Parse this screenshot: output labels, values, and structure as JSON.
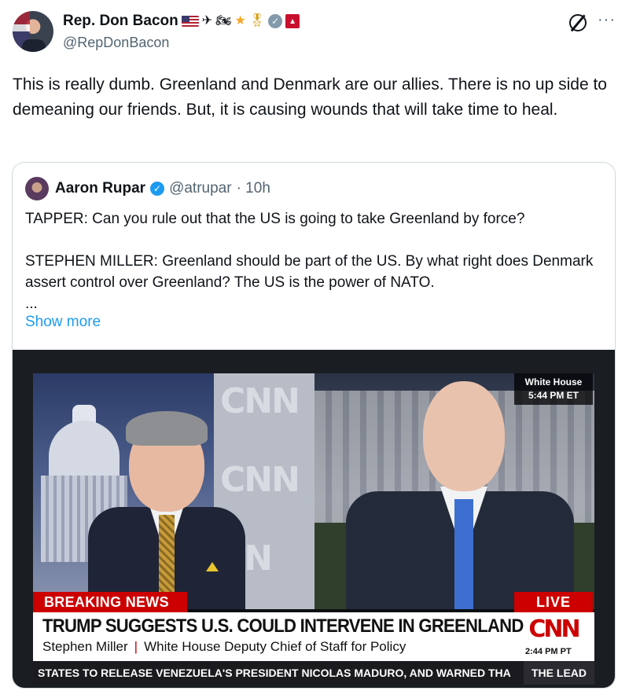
{
  "author": {
    "display_name": "Rep. Don Bacon",
    "handle": "@RepDonBacon",
    "badges": [
      "us-flag-icon",
      "airplane-icon",
      "motorcycle-icon",
      "star-icon",
      "medal-icon",
      "verified-gray-icon",
      "affiliate-badge-icon"
    ]
  },
  "tweet": {
    "text": "This is really dumb. Greenland and Denmark are our allies. There is no up side to demeaning our friends. But, it is causing wounds that will take time to heal."
  },
  "quote": {
    "display_name": "Aaron Rupar",
    "handle": "@atrupar",
    "time": "· 10h",
    "text": "TAPPER: Can you rule out that the US is going to take Greenland by force?\n\nSTEPHEN MILLER: Greenland should be part of the US. By what right does Denmark assert control over Greenland? The US is the power of NATO.\n...",
    "show_more": "Show more"
  },
  "video": {
    "location_label": "White House",
    "location_time": "5:44 PM ET",
    "breaking": "BREAKING NEWS",
    "live": "LIVE",
    "headline": "TRUMP SUGGESTS U.S. COULD INTERVENE IN GREENLAND",
    "guest_name": "Stephen Miller",
    "separator": "|",
    "guest_title": "White House Deputy Chief of Staff for Policy",
    "network_logo": "CNN",
    "network_time": "2:44 PM PT",
    "ticker": "STATES TO RELEASE VENEZUELA'S PRESIDENT NICOLAS MADURO, AND WARNED THA",
    "show_tag": "THE LEAD"
  },
  "colors": {
    "link": "#1d9bf0",
    "secondary_text": "#536471",
    "cnn_red": "#cc0000"
  }
}
